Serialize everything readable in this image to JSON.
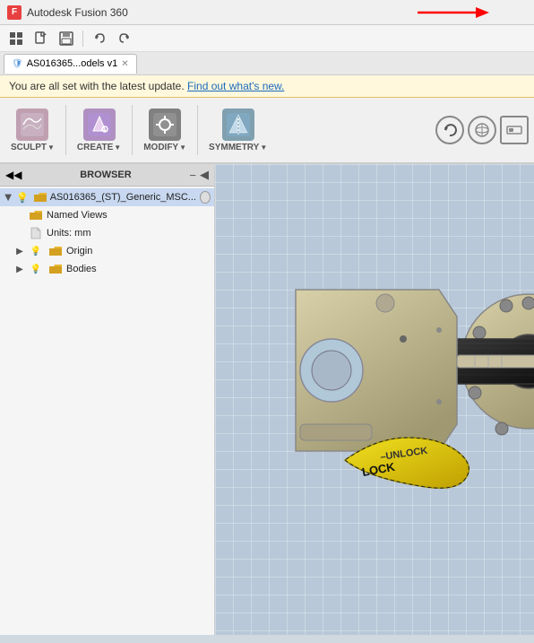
{
  "titleBar": {
    "appName": "Autodesk Fusion 360",
    "icon": "F"
  },
  "toolbar": {
    "buttons": [
      "grid-icon",
      "new-file-icon",
      "save-icon",
      "undo-icon",
      "redo-icon"
    ]
  },
  "tabs": [
    {
      "label": "AS016365...odels v1",
      "active": true
    }
  ],
  "notification": {
    "message": "You are all set with the latest update.",
    "linkText": "Find out what's new."
  },
  "ribbon": {
    "groups": [
      {
        "label": "SCULPT",
        "dropdown": true
      },
      {
        "label": "CREATE",
        "dropdown": true
      },
      {
        "label": "MODIFY",
        "dropdown": true
      },
      {
        "label": "SYMMETRY",
        "dropdown": true
      }
    ]
  },
  "browser": {
    "title": "BROWSER",
    "rootNode": {
      "label": "AS016365_(ST)_Generic_MSC...",
      "expanded": true,
      "children": [
        {
          "label": "Named Views",
          "type": "folder",
          "indent": 1
        },
        {
          "label": "Units: mm",
          "type": "file",
          "indent": 1
        },
        {
          "label": "Origin",
          "type": "folder",
          "indent": 1,
          "hasArrow": true
        },
        {
          "label": "Bodies",
          "type": "folder",
          "indent": 1,
          "hasArrow": true
        }
      ]
    }
  },
  "viewport": {
    "hasModel": true,
    "modelDescription": "AS016365 ST Generic MSC mechanical assembly"
  }
}
